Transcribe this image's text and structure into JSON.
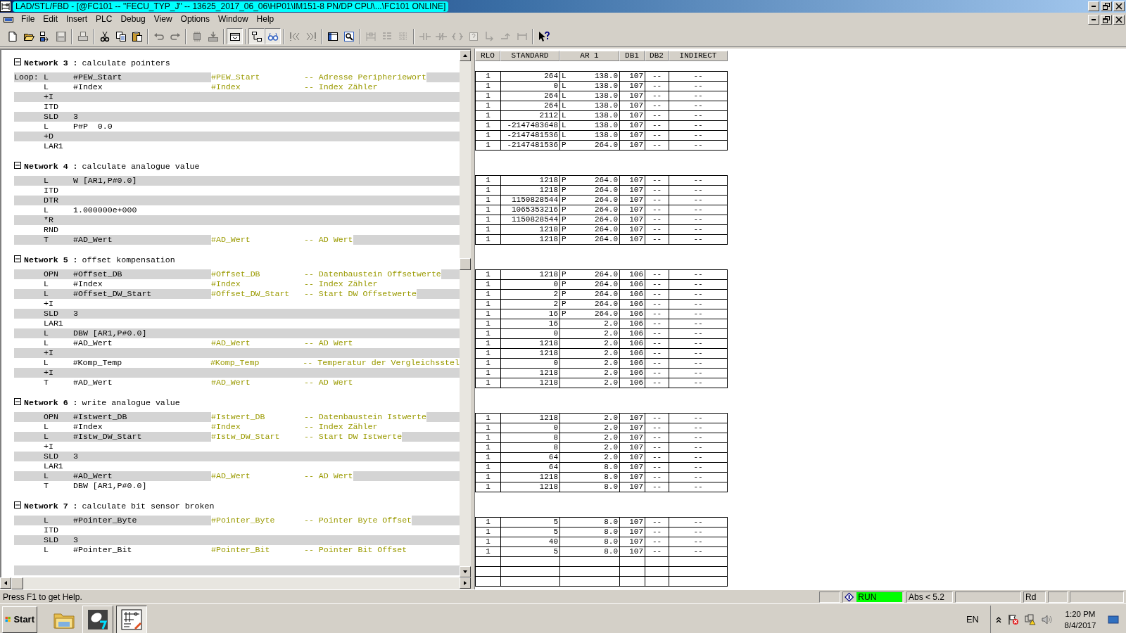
{
  "window": {
    "title": "LAD/STL/FBD  - [@FC101 -- \"FECU_TYP_J\" -- 13625_2017_06_06\\HP01\\IM151-8 PN/DP CPU\\...\\FC101  ONLINE]"
  },
  "menu": [
    "File",
    "Edit",
    "Insert",
    "PLC",
    "Debug",
    "View",
    "Options",
    "Window",
    "Help"
  ],
  "toolbar": [
    [
      {
        "pressed": false,
        "disabled": false
      },
      {
        "pressed": false,
        "disabled": false
      },
      {
        "pressed": false,
        "disabled": false
      },
      {
        "pressed": false,
        "disabled": true
      }
    ],
    [
      {
        "pressed": false,
        "disabled": true
      }
    ],
    [
      {
        "pressed": false,
        "disabled": false
      },
      {
        "pressed": false,
        "disabled": false
      },
      {
        "pressed": false,
        "disabled": false
      }
    ],
    [
      {
        "pressed": false,
        "disabled": true
      },
      {
        "pressed": false,
        "disabled": true
      }
    ],
    [
      {
        "pressed": false,
        "disabled": true
      },
      {
        "pressed": false,
        "disabled": true
      }
    ],
    [
      {
        "pressed": true,
        "disabled": false
      }
    ],
    [
      {
        "pressed": true,
        "disabled": false
      },
      {
        "pressed": true,
        "disabled": false
      }
    ],
    [
      {
        "pressed": false,
        "disabled": true
      },
      {
        "pressed": false,
        "disabled": true
      }
    ],
    [
      {
        "pressed": false,
        "disabled": false
      },
      {
        "pressed": false,
        "disabled": false
      }
    ],
    [
      {
        "pressed": false,
        "disabled": true
      },
      {
        "pressed": false,
        "disabled": true
      },
      {
        "pressed": false,
        "disabled": true
      }
    ],
    [
      {
        "pressed": false,
        "disabled": true
      },
      {
        "pressed": false,
        "disabled": true
      },
      {
        "pressed": false,
        "disabled": true
      },
      {
        "pressed": false,
        "disabled": true
      },
      {
        "pressed": false,
        "disabled": true
      },
      {
        "pressed": false,
        "disabled": true
      },
      {
        "pressed": false,
        "disabled": true
      }
    ],
    [
      {
        "pressed": false,
        "disabled": false
      }
    ]
  ],
  "monitor_columns": [
    "RLO",
    "STANDARD",
    "AR 1",
    "DB1",
    "DB2",
    "INDIRECT"
  ],
  "networks": [
    {
      "heading": "Network 3 :",
      "title": "calculate pointers",
      "expanded": true,
      "lines": [
        {
          "label": "Loop:",
          "op": "L",
          "operand": "#PEW_Start",
          "symbol": "#PEW_Start",
          "comment": "-- Adresse Peripheriewort",
          "monitor": {
            "rlo": "1",
            "standard": "264",
            "area": "L",
            "ar1": "138.0",
            "db1": "107",
            "db2": "--",
            "indirect": "--"
          }
        },
        {
          "op": "L",
          "operand": "#Index",
          "symbol": "#Index",
          "comment": "-- Index Zähler",
          "monitor": {
            "rlo": "1",
            "standard": "0",
            "area": "L",
            "ar1": "138.0",
            "db1": "107",
            "db2": "--",
            "indirect": "--"
          }
        },
        {
          "op": "+I",
          "monitor": {
            "rlo": "1",
            "standard": "264",
            "area": "L",
            "ar1": "138.0",
            "db1": "107",
            "db2": "--",
            "indirect": "--"
          }
        },
        {
          "op": "ITD",
          "monitor": {
            "rlo": "1",
            "standard": "264",
            "area": "L",
            "ar1": "138.0",
            "db1": "107",
            "db2": "--",
            "indirect": "--"
          }
        },
        {
          "op": "SLD",
          "operand": "3",
          "monitor": {
            "rlo": "1",
            "standard": "2112",
            "area": "L",
            "ar1": "138.0",
            "db1": "107",
            "db2": "--",
            "indirect": "--"
          }
        },
        {
          "op": "L",
          "operand": "P#P  0.0",
          "monitor": {
            "rlo": "1",
            "standard": "-2147483648",
            "area": "L",
            "ar1": "138.0",
            "db1": "107",
            "db2": "--",
            "indirect": "--"
          }
        },
        {
          "op": "+D",
          "monitor": {
            "rlo": "1",
            "standard": "-2147481536",
            "area": "L",
            "ar1": "138.0",
            "db1": "107",
            "db2": "--",
            "indirect": "--"
          }
        },
        {
          "op": "LAR1",
          "monitor": {
            "rlo": "1",
            "standard": "-2147481536",
            "area": "P",
            "ar1": "264.0",
            "db1": "107",
            "db2": "--",
            "indirect": "--"
          }
        }
      ]
    },
    {
      "heading": "Network 4 :",
      "title": "calculate analogue value",
      "expanded": true,
      "lines": [
        {
          "op": "L",
          "operand": "W [AR1,P#0.0]",
          "monitor": {
            "rlo": "1",
            "standard": "1218",
            "area": "P",
            "ar1": "264.0",
            "db1": "107",
            "db2": "--",
            "indirect": "--"
          }
        },
        {
          "op": "ITD",
          "monitor": {
            "rlo": "1",
            "standard": "1218",
            "area": "P",
            "ar1": "264.0",
            "db1": "107",
            "db2": "--",
            "indirect": "--"
          }
        },
        {
          "op": "DTR",
          "monitor": {
            "rlo": "1",
            "standard": "1150828544",
            "area": "P",
            "ar1": "264.0",
            "db1": "107",
            "db2": "--",
            "indirect": "--"
          }
        },
        {
          "op": "L",
          "operand": "1.000000e+000",
          "monitor": {
            "rlo": "1",
            "standard": "1065353216",
            "area": "P",
            "ar1": "264.0",
            "db1": "107",
            "db2": "--",
            "indirect": "--"
          }
        },
        {
          "op": "*R",
          "monitor": {
            "rlo": "1",
            "standard": "1150828544",
            "area": "P",
            "ar1": "264.0",
            "db1": "107",
            "db2": "--",
            "indirect": "--"
          }
        },
        {
          "op": "RND",
          "monitor": {
            "rlo": "1",
            "standard": "1218",
            "area": "P",
            "ar1": "264.0",
            "db1": "107",
            "db2": "--",
            "indirect": "--"
          }
        },
        {
          "op": "T",
          "operand": "#AD_Wert",
          "symbol": "#AD_Wert",
          "comment": "-- AD Wert",
          "monitor": {
            "rlo": "1",
            "standard": "1218",
            "area": "P",
            "ar1": "264.0",
            "db1": "107",
            "db2": "--",
            "indirect": "--"
          }
        }
      ]
    },
    {
      "heading": "Network 5 :",
      "title": "offset kompensation",
      "expanded": true,
      "lines": [
        {
          "op": "OPN",
          "operand": "#Offset_DB",
          "symbol": "#Offset_DB",
          "comment": "-- Datenbaustein Offsetwerte",
          "monitor": {
            "rlo": "1",
            "standard": "1218",
            "area": "P",
            "ar1": "264.0",
            "db1": "106",
            "db2": "--",
            "indirect": "--"
          }
        },
        {
          "op": "L",
          "operand": "#Index",
          "symbol": "#Index",
          "comment": "-- Index Zähler",
          "monitor": {
            "rlo": "1",
            "standard": "0",
            "area": "P",
            "ar1": "264.0",
            "db1": "106",
            "db2": "--",
            "indirect": "--"
          }
        },
        {
          "op": "L",
          "operand": "#Offset_DW_Start",
          "symbol": "#Offset_DW_Start",
          "comment": "-- Start DW Offsetwerte",
          "monitor": {
            "rlo": "1",
            "standard": "2",
            "area": "P",
            "ar1": "264.0",
            "db1": "106",
            "db2": "--",
            "indirect": "--"
          }
        },
        {
          "op": "+I",
          "monitor": {
            "rlo": "1",
            "standard": "2",
            "area": "P",
            "ar1": "264.0",
            "db1": "106",
            "db2": "--",
            "indirect": "--"
          }
        },
        {
          "op": "SLD",
          "operand": "3",
          "monitor": {
            "rlo": "1",
            "standard": "16",
            "area": "P",
            "ar1": "264.0",
            "db1": "106",
            "db2": "--",
            "indirect": "--"
          }
        },
        {
          "op": "LAR1",
          "monitor": {
            "rlo": "1",
            "standard": "16",
            "ar1": "2.0",
            "db1": "106",
            "db2": "--",
            "indirect": "--"
          }
        },
        {
          "op": "L",
          "operand": "DBW [AR1,P#0.0]",
          "monitor": {
            "rlo": "1",
            "standard": "0",
            "ar1": "2.0",
            "db1": "106",
            "db2": "--",
            "indirect": "--"
          }
        },
        {
          "op": "L",
          "operand": "#AD_Wert",
          "symbol": "#AD_Wert",
          "comment": "-- AD Wert",
          "monitor": {
            "rlo": "1",
            "standard": "1218",
            "ar1": "2.0",
            "db1": "106",
            "db2": "--",
            "indirect": "--"
          }
        },
        {
          "op": "+I",
          "monitor": {
            "rlo": "1",
            "standard": "1218",
            "ar1": "2.0",
            "db1": "106",
            "db2": "--",
            "indirect": "--"
          }
        },
        {
          "op": "L",
          "operand": "#Komp_Temp",
          "symbol": "#Komp_Temp",
          "comment": "-- Temperatur der Vergleichsstel",
          "monitor": {
            "rlo": "1",
            "standard": "0",
            "ar1": "2.0",
            "db1": "106",
            "db2": "--",
            "indirect": "--"
          }
        },
        {
          "op": "+I",
          "monitor": {
            "rlo": "1",
            "standard": "1218",
            "ar1": "2.0",
            "db1": "106",
            "db2": "--",
            "indirect": "--"
          }
        },
        {
          "op": "T",
          "operand": "#AD_Wert",
          "symbol": "#AD_Wert",
          "comment": "-- AD Wert",
          "monitor": {
            "rlo": "1",
            "standard": "1218",
            "ar1": "2.0",
            "db1": "106",
            "db2": "--",
            "indirect": "--"
          }
        }
      ]
    },
    {
      "heading": "Network 6 :",
      "title": "write analogue value",
      "expanded": true,
      "lines": [
        {
          "op": "OPN",
          "operand": "#Istwert_DB",
          "symbol": "#Istwert_DB",
          "comment": "-- Datenbaustein Istwerte",
          "monitor": {
            "rlo": "1",
            "standard": "1218",
            "ar1": "2.0",
            "db1": "107",
            "db2": "--",
            "indirect": "--"
          }
        },
        {
          "op": "L",
          "operand": "#Index",
          "symbol": "#Index",
          "comment": "-- Index Zähler",
          "monitor": {
            "rlo": "1",
            "standard": "0",
            "ar1": "2.0",
            "db1": "107",
            "db2": "--",
            "indirect": "--"
          }
        },
        {
          "op": "L",
          "operand": "#Istw_DW_Start",
          "symbol": "#Istw_DW_Start",
          "comment": "-- Start DW Istwerte",
          "monitor": {
            "rlo": "1",
            "standard": "8",
            "ar1": "2.0",
            "db1": "107",
            "db2": "--",
            "indirect": "--"
          }
        },
        {
          "op": "+I",
          "monitor": {
            "rlo": "1",
            "standard": "8",
            "ar1": "2.0",
            "db1": "107",
            "db2": "--",
            "indirect": "--"
          }
        },
        {
          "op": "SLD",
          "operand": "3",
          "monitor": {
            "rlo": "1",
            "standard": "64",
            "ar1": "2.0",
            "db1": "107",
            "db2": "--",
            "indirect": "--"
          }
        },
        {
          "op": "LAR1",
          "monitor": {
            "rlo": "1",
            "standard": "64",
            "ar1": "8.0",
            "db1": "107",
            "db2": "--",
            "indirect": "--"
          }
        },
        {
          "op": "L",
          "operand": "#AD_Wert",
          "symbol": "#AD_Wert",
          "comment": "-- AD Wert",
          "monitor": {
            "rlo": "1",
            "standard": "1218",
            "ar1": "8.0",
            "db1": "107",
            "db2": "--",
            "indirect": "--"
          }
        },
        {
          "op": "T",
          "operand": "DBW [AR1,P#0.0]",
          "monitor": {
            "rlo": "1",
            "standard": "1218",
            "ar1": "8.0",
            "db1": "107",
            "db2": "--",
            "indirect": "--"
          }
        }
      ]
    },
    {
      "heading": "Network 7 :",
      "title": "calculate bit sensor broken",
      "expanded": true,
      "lines": [
        {
          "op": "L",
          "operand": "#Pointer_Byte",
          "symbol": "#Pointer_Byte",
          "comment": "-- Pointer Byte Offset",
          "monitor": {
            "rlo": "1",
            "standard": "5",
            "ar1": "8.0",
            "db1": "107",
            "db2": "--",
            "indirect": "--"
          }
        },
        {
          "op": "ITD",
          "monitor": {
            "rlo": "1",
            "standard": "5",
            "ar1": "8.0",
            "db1": "107",
            "db2": "--",
            "indirect": "--"
          }
        },
        {
          "op": "SLD",
          "operand": "3",
          "monitor": {
            "rlo": "1",
            "standard": "40",
            "ar1": "8.0",
            "db1": "107",
            "db2": "--",
            "indirect": "--"
          }
        },
        {
          "op": "L",
          "operand": "#Pointer_Bit",
          "symbol": "#Pointer_Bit",
          "comment": "-- Pointer Bit Offset",
          "monitor": {
            "rlo": "1",
            "standard": "5",
            "ar1": "8.0",
            "db1": "107",
            "db2": "--",
            "indirect": "--"
          }
        }
      ]
    }
  ],
  "status_bar": {
    "help": "Press F1 to get Help.",
    "panels": [
      {
        "kind": "blank"
      },
      {
        "kind": "mode",
        "text": "RUN"
      },
      {
        "kind": "text",
        "text": "Abs < 5.2"
      },
      {
        "kind": "blank"
      },
      {
        "kind": "text",
        "text": "Rd"
      },
      {
        "kind": "blank"
      },
      {
        "kind": "blank"
      }
    ]
  },
  "taskbar": {
    "start": "Start",
    "apps": [
      {
        "running": false,
        "selected": false
      },
      {
        "running": true,
        "selected": false
      },
      {
        "running": true,
        "selected": true
      }
    ],
    "language": "EN",
    "time": "1:20 PM",
    "date": "8/4/2017"
  }
}
